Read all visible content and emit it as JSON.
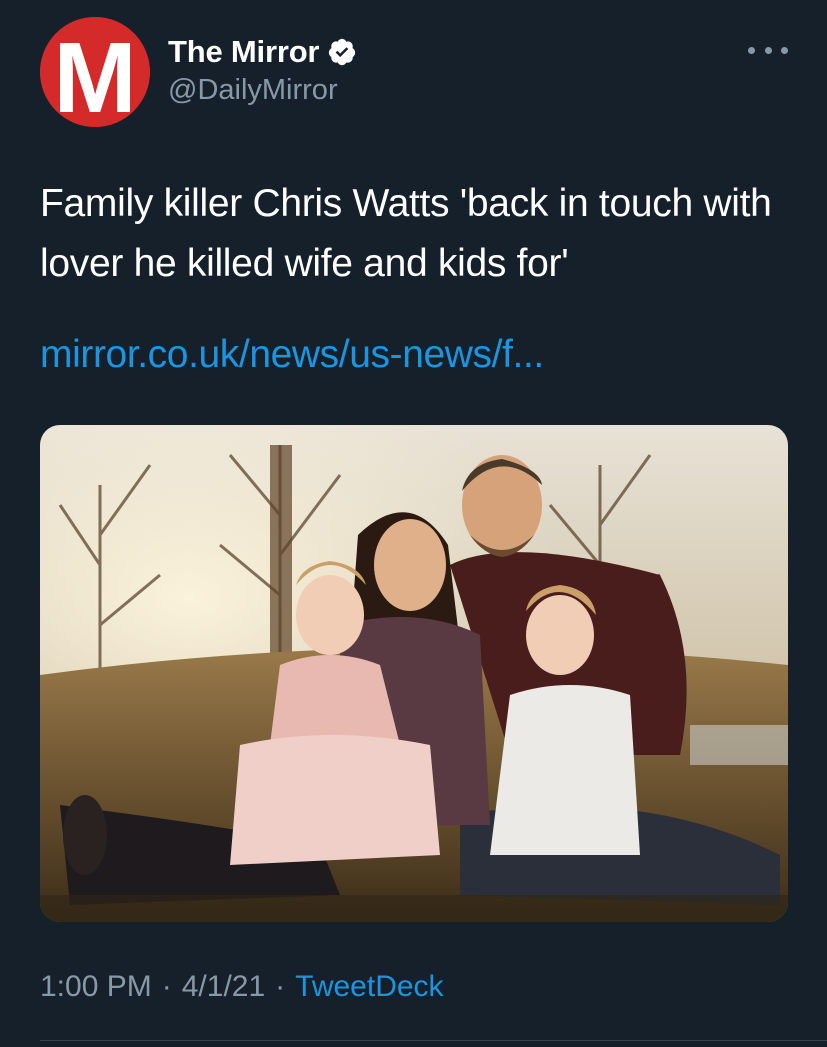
{
  "author": {
    "display_name": "The Mirror",
    "handle": "@DailyMirror",
    "avatar_letter": "M",
    "verified": true,
    "avatar_color": "#d52a2a"
  },
  "tweet": {
    "text": "Family killer Chris Watts 'back in touch with lover he killed wife and kids for'",
    "link": "mirror.co.uk/news/us-news/f...",
    "image_icon": "photo-image"
  },
  "meta": {
    "time": "1:00 PM",
    "date": "4/1/21",
    "separator": "·",
    "source": "TweetDeck"
  },
  "colors": {
    "background": "#15202b",
    "link": "#1b95e0",
    "secondary_text": "#8899a6",
    "verified_badge": "#ffffff"
  },
  "icons": {
    "verified": "verified-badge-icon",
    "more": "more-options-icon"
  }
}
